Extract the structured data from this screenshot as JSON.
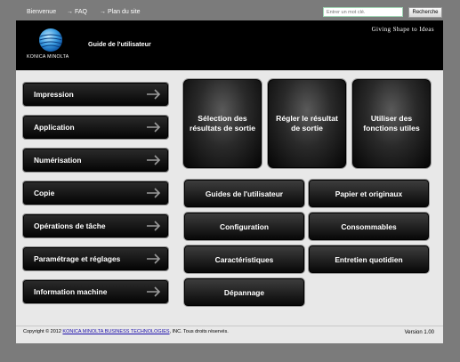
{
  "topbar": {
    "links": [
      {
        "label": "Bienvenue",
        "arrow": false
      },
      {
        "label": "FAQ",
        "arrow": true
      },
      {
        "label": "Plan du site",
        "arrow": true
      }
    ],
    "search": {
      "placeholder": "Entrer un mot clé.",
      "button_label": "Recherche"
    }
  },
  "header": {
    "logo_text": "KONICA MINOLTA",
    "title": "Guide de l'utilisateur",
    "tagline": "Giving Shape to Ideas",
    "logo_colors": {
      "primary": "#1a7fd0",
      "light": "#8fd3ff"
    }
  },
  "left_menu": [
    {
      "label": "Impression"
    },
    {
      "label": "Application"
    },
    {
      "label": "Numérisation"
    },
    {
      "label": "Copie"
    },
    {
      "label": "Opérations de tâche"
    },
    {
      "label": "Paramétrage et réglages"
    },
    {
      "label": "Information machine"
    }
  ],
  "big_buttons": [
    {
      "label": "Sélection des résultats de sortie"
    },
    {
      "label": "Régler le résultat de sortie"
    },
    {
      "label": "Utiliser des fonctions utiles"
    }
  ],
  "medium_buttons": [
    {
      "label": "Guides de l'utilisateur"
    },
    {
      "label": "Papier et originaux"
    },
    {
      "label": "Configuration"
    },
    {
      "label": "Consommables"
    },
    {
      "label": "Caractéristiques"
    },
    {
      "label": "Entretien quotidien"
    },
    {
      "label": "Dépannage"
    }
  ],
  "footer": {
    "copyright_prefix": "Copyright © 2012 ",
    "company_link": "KONICA MINOLTA BUSINESS TECHNOLOGIES",
    "copyright_suffix": ", INC. Tous droits réservés.",
    "version": "Version 1.00"
  }
}
